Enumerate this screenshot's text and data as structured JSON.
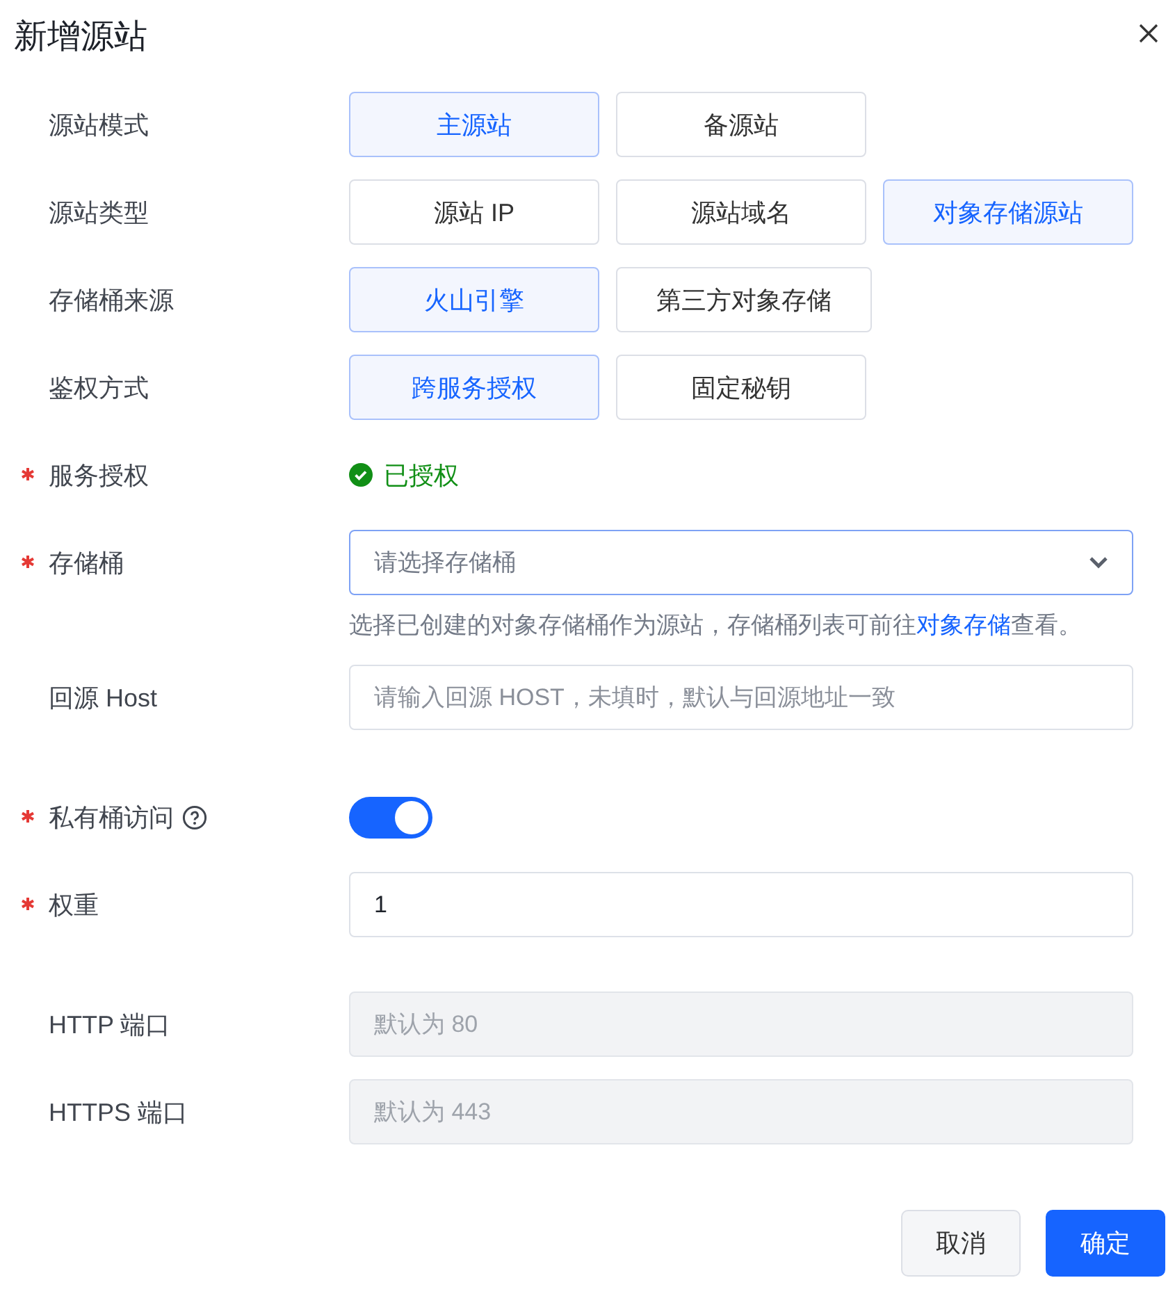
{
  "dialog": {
    "title": "新增源站"
  },
  "sections": [
    [
      {
        "kind": "options",
        "label": "源站模式",
        "required": false,
        "options": [
          {
            "label": "主源站",
            "selected": true
          },
          {
            "label": "备源站",
            "selected": false
          }
        ]
      },
      {
        "kind": "options",
        "label": "源站类型",
        "required": false,
        "options": [
          {
            "label": "源站 IP",
            "selected": false
          },
          {
            "label": "源站域名",
            "selected": false
          },
          {
            "label": "对象存储源站",
            "selected": true
          }
        ]
      },
      {
        "kind": "options",
        "label": "存储桶来源",
        "required": false,
        "options": [
          {
            "label": "火山引擎",
            "selected": true
          },
          {
            "label": "第三方对象存储",
            "selected": false
          }
        ]
      },
      {
        "kind": "options",
        "label": "鉴权方式",
        "required": false,
        "options": [
          {
            "label": "跨服务授权",
            "selected": true
          },
          {
            "label": "固定秘钥",
            "selected": false
          }
        ]
      },
      {
        "kind": "status",
        "label": "服务授权",
        "required": true,
        "status": "已授权"
      },
      {
        "kind": "select",
        "label": "存储桶",
        "required": true,
        "placeholder": "请选择存储桶",
        "hint": {
          "before": "选择已创建的对象存储桶作为源站，存储桶列表可前往",
          "link": "对象存储",
          "after": "查看。"
        }
      },
      {
        "kind": "input",
        "label": "回源 Host",
        "required": false,
        "disabled": false,
        "placeholder": "请输入回源 HOST，未填时，默认与回源地址一致"
      }
    ],
    [
      {
        "kind": "switch",
        "label": "私有桶访问",
        "required": true,
        "help": true,
        "on": true
      },
      {
        "kind": "input",
        "label": "权重",
        "required": true,
        "disabled": false,
        "value": "1"
      }
    ],
    [
      {
        "kind": "input",
        "label": "HTTP 端口",
        "required": false,
        "disabled": true,
        "placeholder": "默认为 80"
      },
      {
        "kind": "input",
        "label": "HTTPS 端口",
        "required": false,
        "disabled": true,
        "placeholder": "默认为 443"
      }
    ]
  ],
  "buttons": [
    {
      "label": "取消",
      "kind": "secondary"
    },
    {
      "label": "确定",
      "kind": "primary"
    }
  ]
}
